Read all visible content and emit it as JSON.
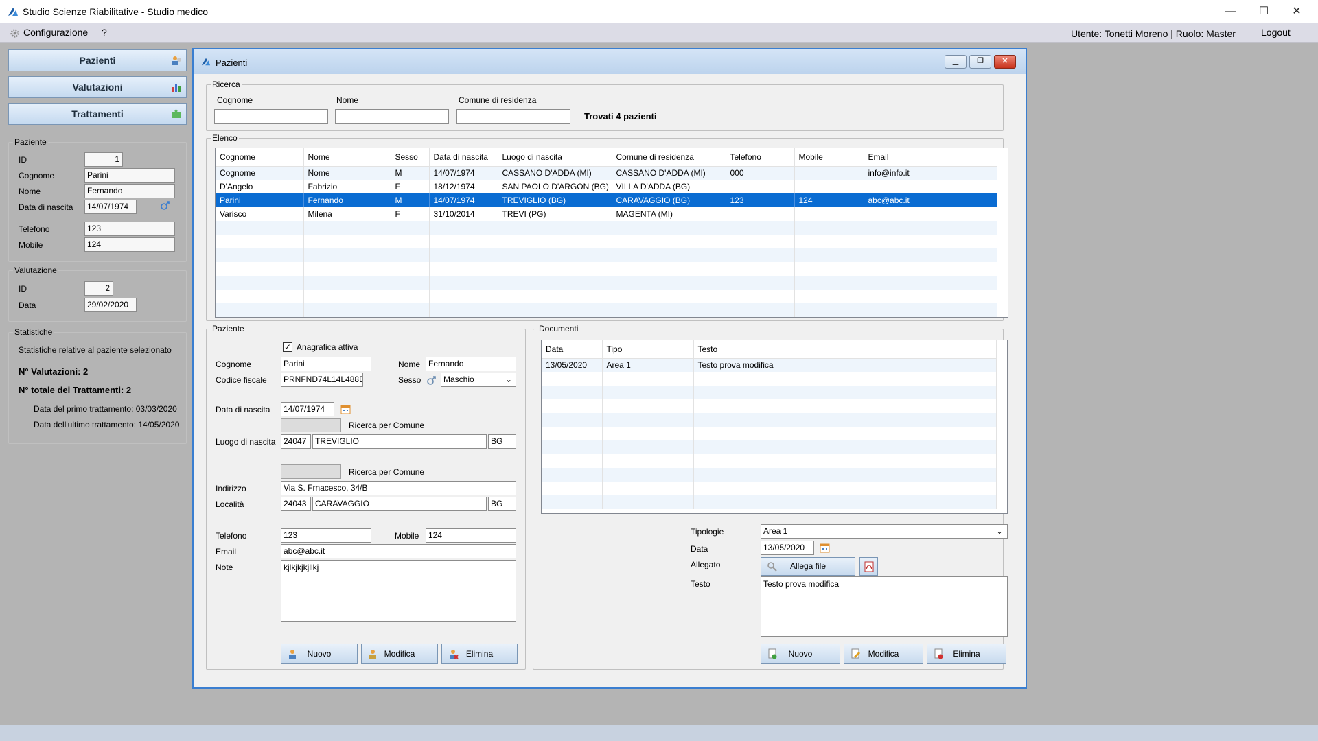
{
  "window": {
    "title": "Studio Scienze Riabilitative - Studio medico",
    "minimize": "—",
    "maximize": "☐",
    "close": "✕"
  },
  "menubar": {
    "config": "Configurazione",
    "help": "?",
    "user_info": "Utente: Tonetti Moreno | Ruolo: Master",
    "logout": "Logout"
  },
  "sidebar": {
    "nav": [
      "Pazienti",
      "Valutazioni",
      "Trattamenti"
    ],
    "paziente": {
      "legend": "Paziente",
      "id_label": "ID",
      "id": "1",
      "cognome_label": "Cognome",
      "cognome": "Parini",
      "nome_label": "Nome",
      "nome": "Fernando",
      "nascita_label": "Data di nascita",
      "nascita": "14/07/1974",
      "telefono_label": "Telefono",
      "telefono": "123",
      "mobile_label": "Mobile",
      "mobile": "124"
    },
    "valutazione": {
      "legend": "Valutazione",
      "id_label": "ID",
      "id": "2",
      "data_label": "Data",
      "data": "29/02/2020"
    },
    "statistiche": {
      "legend": "Statistiche",
      "desc": "Statistiche relative al paziente selezionato",
      "n_valutazioni": "N° Valutazioni: 2",
      "n_trattamenti": "N° totale dei Trattamenti: 2",
      "primo": "Data del primo trattamento: 03/03/2020",
      "ultimo": "Data dell'ultimo trattamento: 14/05/2020"
    }
  },
  "mdi": {
    "title": "Pazienti",
    "ricerca": {
      "legend": "Ricerca",
      "cognome_label": "Cognome",
      "nome_label": "Nome",
      "comune_label": "Comune di residenza",
      "result": "Trovati 4 pazienti"
    },
    "elenco": {
      "legend": "Elenco",
      "columns": [
        "Cognome",
        "Nome",
        "Sesso",
        "Data di nascita",
        "Luogo di nascita",
        "Comune di residenza",
        "Telefono",
        "Mobile",
        "Email"
      ],
      "rows": [
        [
          "Cognome",
          "Nome",
          "M",
          "14/07/1974",
          "CASSANO D'ADDA (MI)",
          "CASSANO D'ADDA (MI)",
          "000",
          "",
          "info@info.it"
        ],
        [
          "D'Angelo",
          "Fabrizio",
          "F",
          "18/12/1974",
          "SAN PAOLO D'ARGON (BG)",
          "VILLA D'ADDA (BG)",
          "",
          "",
          ""
        ],
        [
          "Parini",
          "Fernando",
          "M",
          "14/07/1974",
          "TREVIGLIO (BG)",
          "CARAVAGGIO (BG)",
          "123",
          "124",
          "abc@abc.it"
        ],
        [
          "Varisco",
          "Milena",
          "F",
          "31/10/2014",
          "TREVI (PG)",
          "MAGENTA (MI)",
          "",
          "",
          ""
        ]
      ],
      "selected_row": 2
    },
    "paziente": {
      "legend": "Paziente",
      "attiva_label": "Anagrafica attiva",
      "cognome_label": "Cognome",
      "cognome": "Parini",
      "nome_label": "Nome",
      "nome": "Fernando",
      "cf_label": "Codice fiscale",
      "cf": "PRNFND74L14L488D",
      "sesso_label": "Sesso",
      "sesso": "Maschio",
      "nascita_label": "Data di nascita",
      "nascita": "14/07/1974",
      "ricerca_comune": "Ricerca per Comune",
      "luogo_label": "Luogo di nascita",
      "luogo_cap": "24047",
      "luogo_city": "TREVIGLIO",
      "luogo_prov": "BG",
      "indirizzo_label": "Indirizzo",
      "indirizzo": "Via S. Frnacesco, 34/B",
      "localita_label": "Località",
      "loc_cap": "24043",
      "loc_city": "CARAVAGGIO",
      "loc_prov": "BG",
      "telefono_label": "Telefono",
      "telefono": "123",
      "mobile_label": "Mobile",
      "mobile": "124",
      "email_label": "Email",
      "email": "abc@abc.it",
      "note_label": "Note",
      "note": "kjlkjkjkjllkj",
      "btn_nuovo": "Nuovo",
      "btn_modifica": "Modifica",
      "btn_elimina": "Elimina"
    },
    "documenti": {
      "legend": "Documenti",
      "columns": [
        "Data",
        "Tipo",
        "Testo"
      ],
      "rows": [
        [
          "13/05/2020",
          "Area 1",
          "Testo prova modifica"
        ]
      ],
      "tipologie_label": "Tipologie",
      "tipologie": "Area 1",
      "data_label": "Data",
      "data": "13/05/2020",
      "allegato_label": "Allegato",
      "allega_btn": "Allega file",
      "testo_label": "Testo",
      "testo": "Testo prova modifica",
      "btn_nuovo": "Nuovo",
      "btn_modifica": "Modifica",
      "btn_elimina": "Elimina"
    }
  }
}
